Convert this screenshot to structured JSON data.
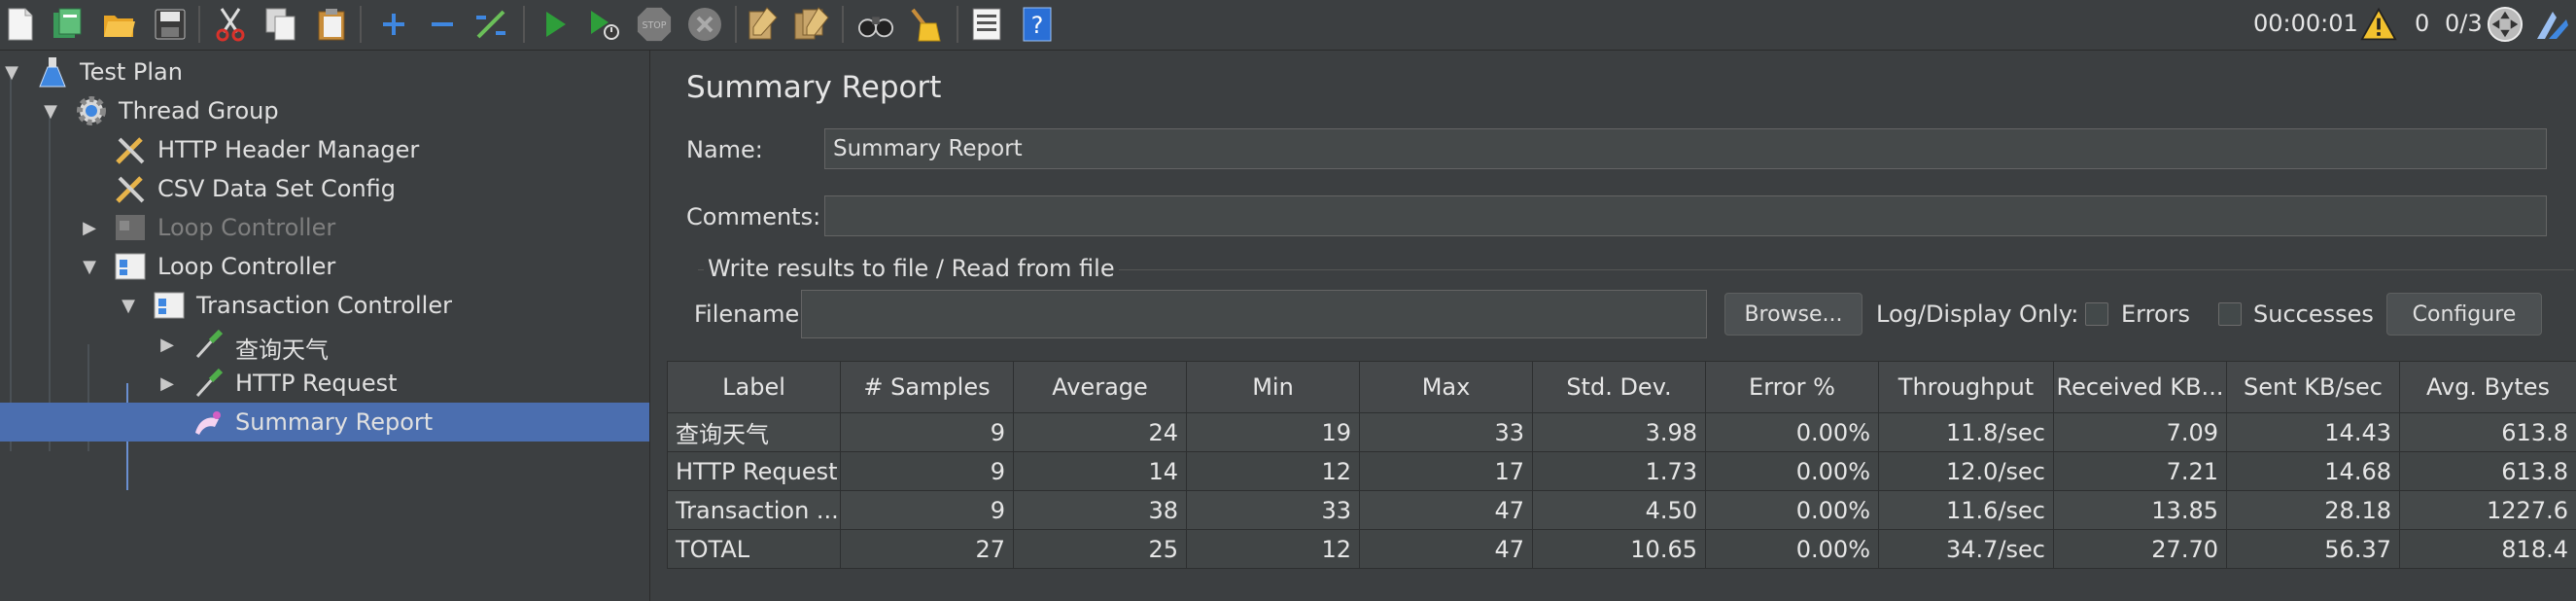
{
  "toolbar": {
    "icons": [
      "new-icon",
      "templates-icon",
      "open-icon",
      "save-icon",
      "cut-icon",
      "copy-icon",
      "paste-icon",
      "expand-icon",
      "collapse-icon",
      "toggle-icon",
      "start-icon",
      "start-no-timers-icon",
      "stop-icon",
      "shutdown-icon",
      "clear-icon",
      "clear-all-icon",
      "search-icon",
      "reset-search-icon",
      "function-helper-icon",
      "help-icon"
    ],
    "timer": "00:00:01",
    "warning_count": "0",
    "threads": "0/3"
  },
  "tree": [
    {
      "label": "Test Plan",
      "icon": "flask-icon",
      "expanded": true,
      "disabled": false,
      "selected": false
    },
    {
      "label": "Thread Group",
      "icon": "gear-icon",
      "expanded": true,
      "disabled": false,
      "selected": false
    },
    {
      "label": "HTTP Header Manager",
      "icon": "wrench-icon",
      "disabled": false,
      "selected": false
    },
    {
      "label": "CSV Data Set Config",
      "icon": "wrench-icon",
      "disabled": false,
      "selected": false
    },
    {
      "label": "Loop Controller",
      "icon": "controller-icon",
      "expanded": false,
      "disabled": true,
      "selected": false
    },
    {
      "label": "Loop Controller",
      "icon": "controller-icon",
      "expanded": true,
      "disabled": false,
      "selected": false
    },
    {
      "label": "Transaction Controller",
      "icon": "controller-icon",
      "expanded": true,
      "disabled": false,
      "selected": false
    },
    {
      "label": "查询天气",
      "icon": "pipette-icon",
      "expanded": false,
      "disabled": false,
      "selected": false
    },
    {
      "label": "HTTP Request",
      "icon": "pipette-icon",
      "expanded": false,
      "disabled": false,
      "selected": false
    },
    {
      "label": "Summary Report",
      "icon": "listener-icon",
      "disabled": false,
      "selected": true
    }
  ],
  "panel": {
    "title": "Summary Report",
    "name_label": "Name:",
    "name_value": "Summary Report",
    "comments_label": "Comments:",
    "comments_value": "",
    "file_group_title": "Write results to file / Read from file",
    "filename_label": "Filename",
    "filename_value": "",
    "browse_label": "Browse...",
    "log_display_label": "Log/Display Only:",
    "errors_label": "Errors",
    "successes_label": "Successes",
    "configure_label": "Configure"
  },
  "table": {
    "columns": [
      "Label",
      "# Samples",
      "Average",
      "Min",
      "Max",
      "Std. Dev.",
      "Error %",
      "Throughput",
      "Received KB...",
      "Sent KB/sec",
      "Avg. Bytes"
    ],
    "rows": [
      [
        "查询天气",
        "9",
        "24",
        "19",
        "33",
        "3.98",
        "0.00%",
        "11.8/sec",
        "7.09",
        "14.43",
        "613.8"
      ],
      [
        "HTTP Request",
        "9",
        "14",
        "12",
        "17",
        "1.73",
        "0.00%",
        "12.0/sec",
        "7.21",
        "14.68",
        "613.8"
      ],
      [
        "Transaction ...",
        "9",
        "38",
        "33",
        "47",
        "4.50",
        "0.00%",
        "11.6/sec",
        "13.85",
        "28.18",
        "1227.6"
      ],
      [
        "TOTAL",
        "27",
        "25",
        "12",
        "47",
        "10.65",
        "0.00%",
        "34.7/sec",
        "27.70",
        "56.37",
        "818.4"
      ]
    ]
  },
  "colors": {
    "background": "#3c3f41",
    "selection": "#4b6eaf",
    "input": "#45494a",
    "start_green": "#2e9e3a",
    "warning_yellow": "#f2c12e",
    "help_blue": "#2a6fd6"
  }
}
